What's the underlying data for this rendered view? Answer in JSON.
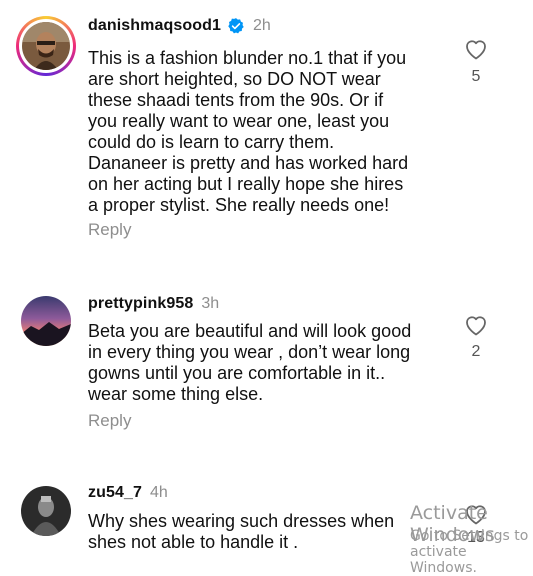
{
  "comments": [
    {
      "username": "danishmaqsood1",
      "verified": true,
      "time": "2h",
      "lines": [
        "This is a fashion blunder no.1 that if you",
        "are short heighted, so DO NOT wear",
        "these shaadi tents from the 90s. Or if",
        "you really want to wear one, least you",
        "could do is learn to carry them.",
        "Dananeer is pretty and has worked hard",
        "on her acting but I really hope she hires",
        "a proper stylist. She really needs one!"
      ],
      "reply_label": "Reply",
      "like_count": "5"
    },
    {
      "username": "prettypink958",
      "time": "3h",
      "lines": [
        "Beta you are beautiful and will look good",
        "in every thing you wear , don’t wear long",
        "gowns until you are comfortable in it..",
        "wear  some thing else."
      ],
      "reply_label": "Reply",
      "like_count": "2"
    },
    {
      "username": "zu54_7",
      "time": "4h",
      "lines": [
        "Why shes wearing such dresses when",
        "shes not able to handle it ."
      ],
      "like_count": "13"
    }
  ],
  "watermark": {
    "line1": "Activate Windows",
    "line2": "Go to Settings to activate Windows."
  },
  "colors": {
    "text": "#111111",
    "muted": "#8e8e8e",
    "verified_blue": "#0095f6"
  },
  "icons": {
    "like": "heart-outline-icon",
    "verified": "verified-badge-icon"
  }
}
